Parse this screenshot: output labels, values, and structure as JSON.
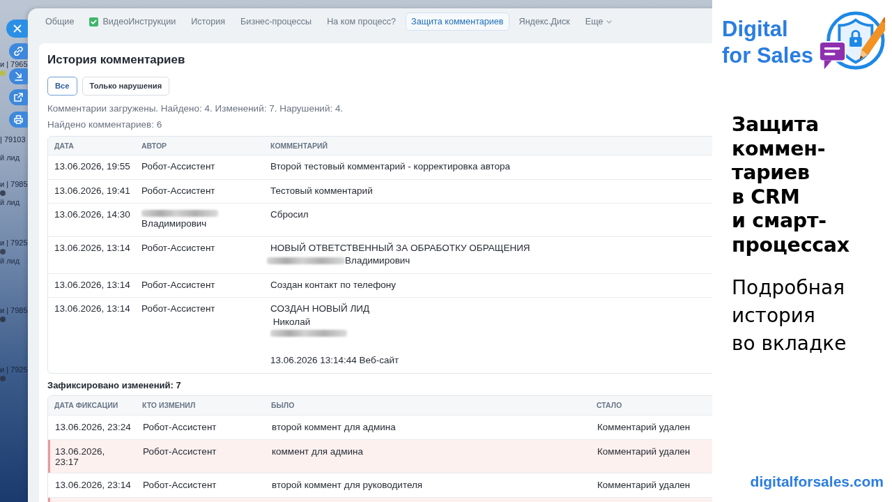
{
  "background_list": [
    {
      "title": "и | 7965",
      "color": "#b9bd45"
    },
    {
      "title": "| 79103",
      "subtitle": "й лид"
    },
    {
      "title": "и | 7985",
      "color": "#3b4558",
      "subtitle": "й лид"
    },
    {
      "title": "и | 7925",
      "color": "#3b4558",
      "subtitle": "й лид"
    },
    {
      "title": "и | 7985",
      "color": "#2f3a4f"
    },
    {
      "title": "и | 7925",
      "color": "#2f3a4f"
    }
  ],
  "tabs": [
    {
      "label": "Общие",
      "selected": false,
      "checked": false,
      "kind": "tab"
    },
    {
      "label": "ВидеоИнструкции",
      "selected": false,
      "checked": true,
      "kind": "tab"
    },
    {
      "label": "История",
      "selected": false,
      "checked": false,
      "kind": "tab"
    },
    {
      "label": "Бизнес-процессы",
      "selected": false,
      "checked": false,
      "kind": "tab"
    },
    {
      "label": "На ком процесс?",
      "selected": false,
      "checked": false,
      "kind": "tab"
    },
    {
      "label": "Защита комментариев",
      "selected": true,
      "checked": false,
      "kind": "tab"
    },
    {
      "label": "Яндекс.Диск",
      "selected": false,
      "checked": false,
      "kind": "tab"
    },
    {
      "label": "Еще",
      "selected": false,
      "checked": false,
      "kind": "menu"
    }
  ],
  "history": {
    "title": "История комментариев",
    "filters": [
      {
        "label": "Все",
        "selected": true
      },
      {
        "label": "Только нарушения",
        "selected": false
      }
    ],
    "status": "Комментарии загружены. Найдено: 4. Изменений: 7. Нарушений: 4.",
    "count": "Найдено комментариев: 6",
    "table": {
      "columns": [
        "ДАТА",
        "АВТОР",
        "КОММЕНТАРИЙ"
      ],
      "rows": [
        {
          "date": "13.06.2026, 19:55",
          "author": "Робот-Ассистент",
          "comment": "Второй тестовый комментарий - корректировка автора"
        },
        {
          "date": "13.06.2026, 19:41",
          "author": "Робот-Ассистент",
          "comment": "Тестовый комментарий"
        },
        {
          "date": "13.06.2026, 14:30",
          "author": {
            "lines": [
              {
                "kind": "masked"
              },
              {
                "kind": "text",
                "text": "Владимирович"
              }
            ]
          },
          "comment": "Сбросил"
        },
        {
          "date": "13.06.2026, 13:14",
          "author": "Робот-Ассистент",
          "comment": {
            "lines": [
              {
                "kind": "text",
                "text": "НОВЫЙ ОТВЕТСТВЕННЫЙ ЗА ОБРАБОТКУ ОБРАЩЕНИЯ"
              },
              {
                "kind": "masked",
                "text": "Владимирович"
              }
            ]
          }
        },
        {
          "date": "13.06.2026, 13:14",
          "author": "Робот-Ассистент",
          "comment": "Создан контакт по телефону"
        },
        {
          "date": "13.06.2026, 13:14",
          "author": "Робот-Ассистент",
          "comment": {
            "lines": [
              {
                "kind": "text",
                "text": "СОЗДАН НОВЫЙ ЛИД"
              },
              {
                "kind": "text",
                "text": " Николай"
              },
              {
                "kind": "masked"
              },
              {
                "kind": "spaced",
                "text": "13.06.2026 13:14:44 Веб-сайт"
              }
            ]
          }
        }
      ]
    }
  },
  "changes": {
    "title": "Зафиксировано изменений: 7",
    "table": {
      "columns": [
        "ДАТА ФИКСАЦИИ",
        "КТО ИЗМЕНИЛ",
        "БЫЛО",
        "СТАЛО"
      ],
      "rows": [
        {
          "date": "13.06.2026, 23:24",
          "author": "Робот-Ассистент",
          "before": "второй коммент для админа",
          "after": "Комментарий удален",
          "violation": false
        },
        {
          "date": "13.06.2026, 23:17",
          "author": "Робот-Ассистент",
          "before": "коммент для админа",
          "after": "Комментарий удален",
          "violation": true
        },
        {
          "date": "13.06.2026, 23:14",
          "author": "Робот-Ассистент",
          "before": "второй коммент для руководителя",
          "after": "Комментарий удален",
          "violation": false
        },
        {
          "violation": true
        }
      ]
    }
  },
  "promo": {
    "brand_lines": [
      "Digital",
      "for Sales"
    ],
    "headline_lines": [
      "Защита",
      "коммен-",
      "тариев",
      "в CRM",
      "и смарт-",
      "процессах"
    ],
    "subtitle_lines": [
      "Подробная",
      "история",
      "во вкладке"
    ],
    "url": "digitalforsales.com"
  }
}
